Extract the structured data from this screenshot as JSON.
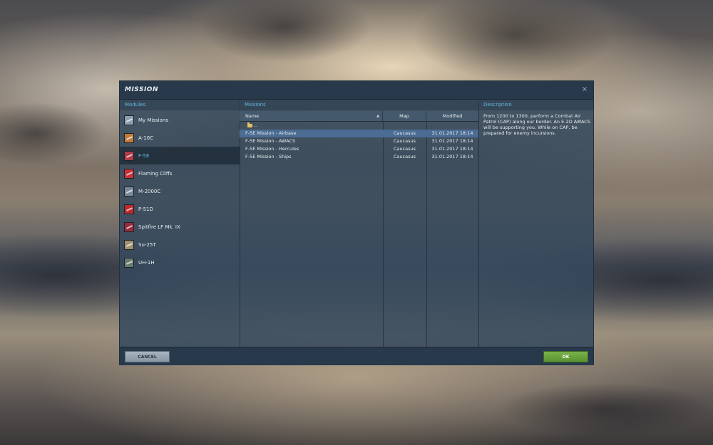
{
  "window": {
    "title": "MISSION",
    "close_glyph": "×"
  },
  "modules": {
    "header": "Modules",
    "items": [
      {
        "label": "My Missions",
        "icon": "my-missions-icon",
        "color": "#8aa0b0",
        "selected": false
      },
      {
        "label": "A-10C",
        "icon": "a10c-icon",
        "color": "#c27a3a",
        "selected": false
      },
      {
        "label": "F-5E",
        "icon": "f5e-icon",
        "color": "#b03a4a",
        "selected": true
      },
      {
        "label": "Flaming Cliffs",
        "icon": "flaming-cliffs-icon",
        "color": "#c8303a",
        "selected": false
      },
      {
        "label": "M-2000C",
        "icon": "m2000c-icon",
        "color": "#7a8a9a",
        "selected": false
      },
      {
        "label": "P-51D",
        "icon": "p51d-icon",
        "color": "#c02a2a",
        "selected": false
      },
      {
        "label": "Spitfire LF Mk. IX",
        "icon": "spitfire-icon",
        "color": "#9a2a3a",
        "selected": false
      },
      {
        "label": "Su-25T",
        "icon": "su25t-icon",
        "color": "#a09070",
        "selected": false
      },
      {
        "label": "UH-1H",
        "icon": "uh1h-icon",
        "color": "#6a7a70",
        "selected": false
      }
    ]
  },
  "missions": {
    "header": "Missions",
    "columns": {
      "name": "Name",
      "map": "Map",
      "modified": "Modified"
    },
    "up_dir": "..",
    "rows": [
      {
        "name": "F-5E Mission - Airbase",
        "map": "Caucasus",
        "modified": "31.01.2017 18:14",
        "selected": true
      },
      {
        "name": "F-5E Mission - AWACS",
        "map": "Caucasus",
        "modified": "31.01.2017 18:14",
        "selected": false
      },
      {
        "name": "F-5E Mission - Hercules",
        "map": "Caucasus",
        "modified": "31.01.2017 18:14",
        "selected": false
      },
      {
        "name": "F-5E Mission - Ships",
        "map": "Caucasus",
        "modified": "31.01.2017 18:14",
        "selected": false
      }
    ]
  },
  "description": {
    "header": "Description",
    "text": "From 1200 to 1300, perform a Combat Air Patrol (CAP) along our border. An E-2D AWACS will be supporting you. While on CAP, be prepared for enemy incursions."
  },
  "footer": {
    "cancel_label": "CANCEL",
    "ok_label": "OK"
  },
  "colors": {
    "accent": "#63b7de",
    "ok_button": "#6aa33c",
    "selected_row": "#4c6e96"
  }
}
